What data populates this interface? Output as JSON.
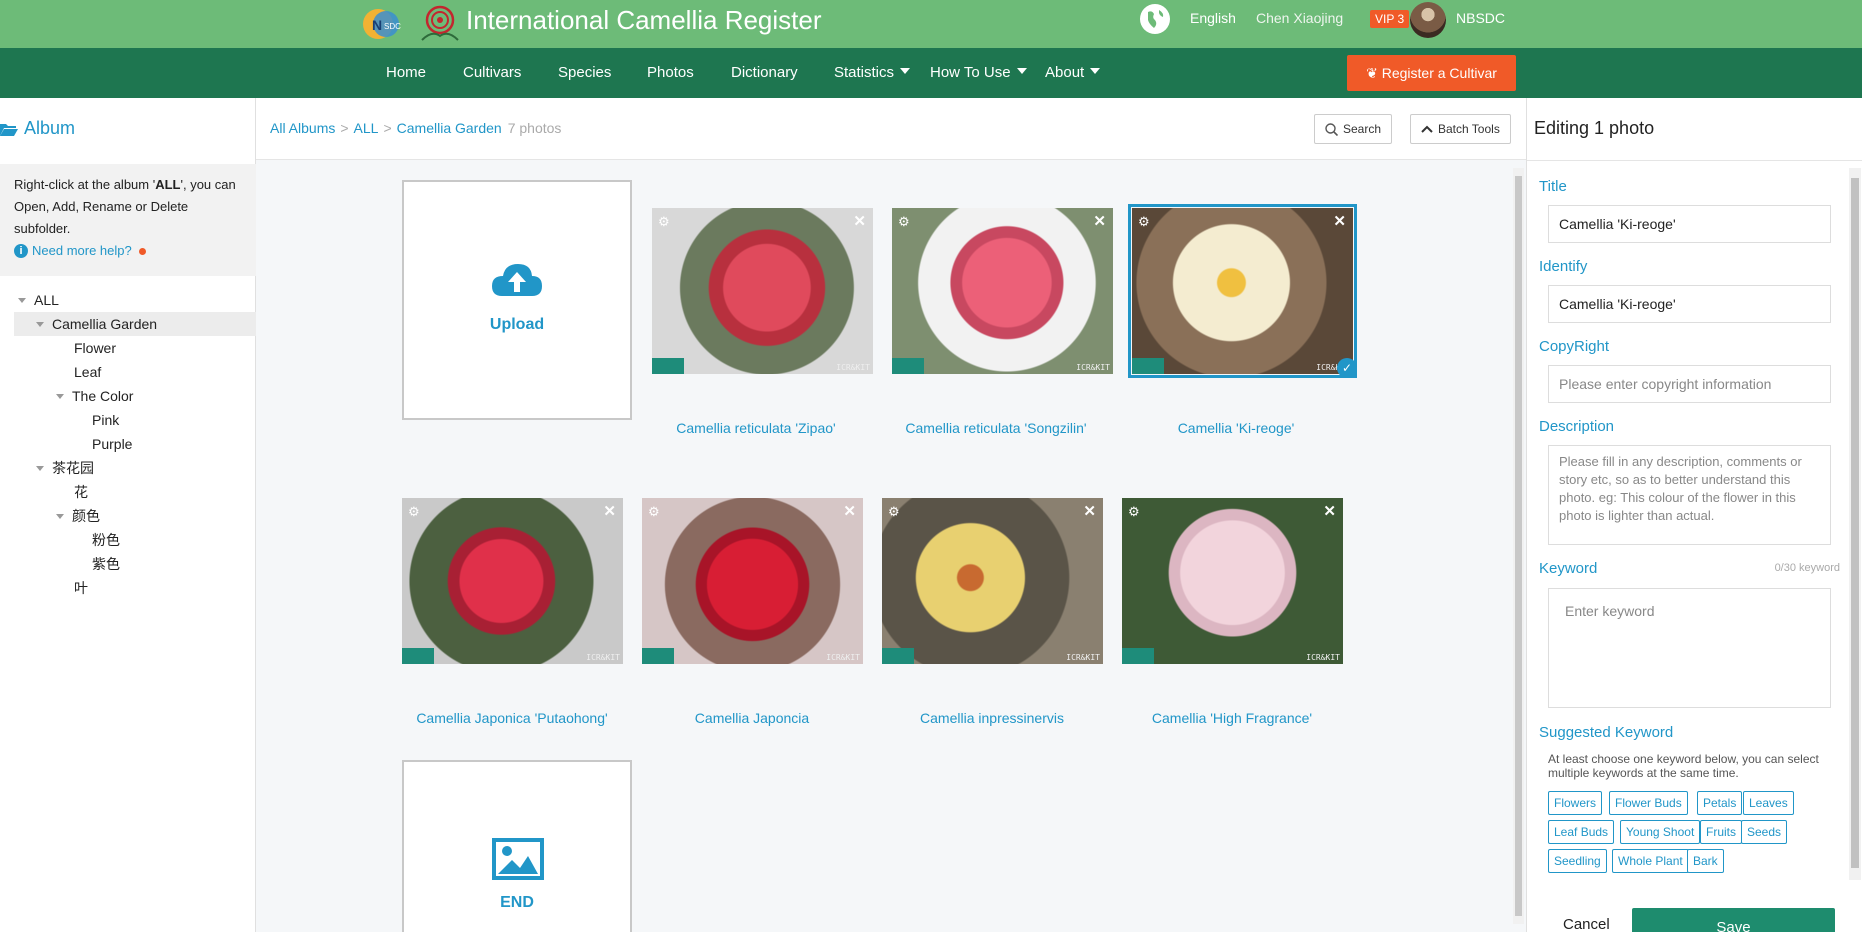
{
  "header": {
    "logo_text": "NSDC",
    "title": "International Camellia Register",
    "language": "English",
    "user_name": "Chen Xiaojing",
    "vip_badge": "VIP 3",
    "org": "NBSDC"
  },
  "nav": {
    "items": [
      {
        "label": "Home",
        "dropdown": false
      },
      {
        "label": "Cultivars",
        "dropdown": false
      },
      {
        "label": "Species",
        "dropdown": false
      },
      {
        "label": "Photos",
        "dropdown": false
      },
      {
        "label": "Dictionary",
        "dropdown": false
      },
      {
        "label": "Statistics",
        "dropdown": true
      },
      {
        "label": "How To Use",
        "dropdown": true
      },
      {
        "label": "About",
        "dropdown": true
      }
    ],
    "register_button": "Register a Cultivar"
  },
  "sidebar": {
    "title": "Album",
    "help_prefix": "Right-click at the album '",
    "help_bold": "ALL",
    "help_suffix": "', you can Open, Add, Rename or Delete subfolder.",
    "help_link": "Need more help?",
    "tree": [
      {
        "label": "ALL",
        "expanded": true,
        "selected": false
      },
      {
        "label": "Camellia Garden",
        "expanded": true,
        "selected": true
      },
      {
        "label": "Flower",
        "expanded": false,
        "selected": false
      },
      {
        "label": "Leaf",
        "expanded": false,
        "selected": false
      },
      {
        "label": "The Color",
        "expanded": true,
        "selected": false
      },
      {
        "label": "Pink",
        "expanded": false,
        "selected": false
      },
      {
        "label": "Purple",
        "expanded": false,
        "selected": false
      },
      {
        "label": "茶花园",
        "expanded": true,
        "selected": false
      },
      {
        "label": "花",
        "expanded": false,
        "selected": false
      },
      {
        "label": "颜色",
        "expanded": true,
        "selected": false
      },
      {
        "label": "粉色",
        "expanded": false,
        "selected": false
      },
      {
        "label": "紫色",
        "expanded": false,
        "selected": false
      },
      {
        "label": "叶",
        "expanded": false,
        "selected": false
      }
    ]
  },
  "main": {
    "breadcrumb": [
      "All Albums",
      "ALL",
      "Camellia Garden"
    ],
    "photo_count": "7 photos",
    "search_button": "Search",
    "batch_button": "Batch Tools",
    "upload_label": "Upload",
    "end_label": "END",
    "watermark": "ICR&KIT",
    "photos": [
      {
        "caption": "Camellia reticulata 'Zipao'",
        "color": "#e04a5c",
        "selected": false
      },
      {
        "caption": "Camellia reticulata 'Songzilin'",
        "color": "#ec6078",
        "selected": false
      },
      {
        "caption": "Camellia 'Ki-reoge'",
        "color": "#f4ecd0",
        "selected": true
      },
      {
        "caption": "Camellia Japonica 'Putaohong'",
        "color": "#e0304a",
        "selected": false
      },
      {
        "caption": "Camellia Japoncia",
        "color": "#d81e34",
        "selected": false
      },
      {
        "caption": "Camellia inpressinervis",
        "color": "#e8d070",
        "selected": false
      },
      {
        "caption": "Camellia 'High Fragrance'",
        "color": "#f2d4dc",
        "selected": false
      }
    ]
  },
  "editor": {
    "title": "Editing 1 photo",
    "title_label": "Title",
    "title_value": "Camellia 'Ki-reoge'",
    "identify_label": "Identify",
    "identify_value": "Camellia 'Ki-reoge'",
    "copyright_label": "CopyRight",
    "copyright_placeholder": "Please enter copyright information",
    "description_label": "Description",
    "description_placeholder": "Please fill in any description, comments or story etc, so as to better understand this photo. eg: This colour of the flower in this photo is lighter than actual.",
    "keyword_label": "Keyword",
    "keyword_count": "0/30 keyword",
    "keyword_placeholder": "Enter keyword",
    "suggested_label": "Suggested Keyword",
    "suggested_hint": "At least choose one keyword below, you can select multiple keywords at the same time.",
    "tags": [
      "Flowers",
      "Flower Buds",
      "Petals",
      "Leaves",
      "Leaf Buds",
      "Young Shoot",
      "Fruits",
      "Seeds",
      "Seedling",
      "Whole Plant",
      "Bark"
    ],
    "cancel_label": "Cancel",
    "save_label": "Save"
  },
  "colors": {
    "header_green": "#6dbb78",
    "nav_green": "#1e7650",
    "accent_blue": "#2196c8",
    "register_orange": "#f05a28",
    "save_green": "#1e8c6e"
  }
}
